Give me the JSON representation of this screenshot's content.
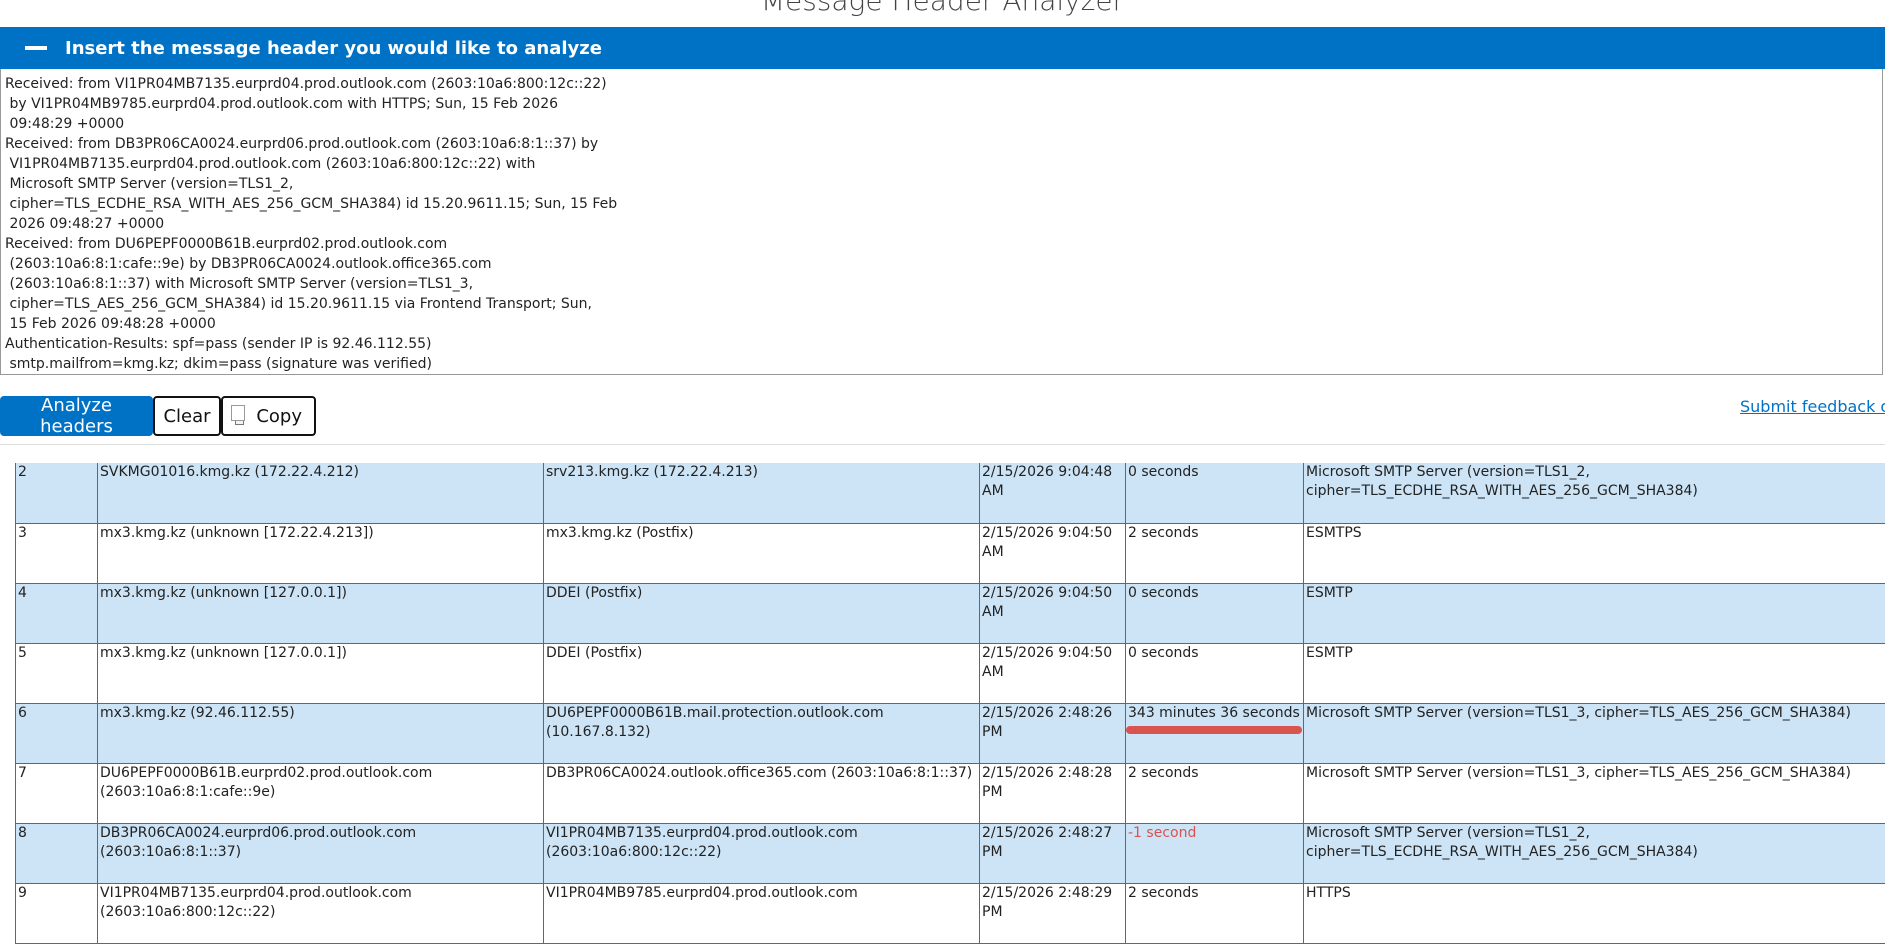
{
  "app": {
    "title": "Message Header Analyzer"
  },
  "section": {
    "title": "Insert the message header you would like to analyze"
  },
  "header_text": "Received: from VI1PR04MB7135.eurprd04.prod.outlook.com (2603:10a6:800:12c::22)\n by VI1PR04MB9785.eurprd04.prod.outlook.com with HTTPS; Sun, 15 Feb 2026\n 09:48:29 +0000\nReceived: from DB3PR06CA0024.eurprd06.prod.outlook.com (2603:10a6:8:1::37) by\n VI1PR04MB7135.eurprd04.prod.outlook.com (2603:10a6:800:12c::22) with\n Microsoft SMTP Server (version=TLS1_2,\n cipher=TLS_ECDHE_RSA_WITH_AES_256_GCM_SHA384) id 15.20.9611.15; Sun, 15 Feb\n 2026 09:48:27 +0000\nReceived: from DU6PEPF0000B61B.eurprd02.prod.outlook.com\n (2603:10a6:8:1:cafe::9e) by DB3PR06CA0024.outlook.office365.com\n (2603:10a6:8:1::37) with Microsoft SMTP Server (version=TLS1_3,\n cipher=TLS_AES_256_GCM_SHA384) id 15.20.9611.15 via Frontend Transport; Sun,\n 15 Feb 2026 09:48:28 +0000\nAuthentication-Results: spf=pass (sender IP is 92.46.112.55)\n smtp.mailfrom=kmg.kz; dkim=pass (signature was verified)",
  "toolbar": {
    "analyze_label": "Analyze headers",
    "clear_label": "Clear",
    "copy_label": "Copy",
    "feedback_label": "Submit feedback on g"
  },
  "hops": [
    {
      "hop": "2",
      "from": "SVKMG01016.kmg.kz (172.22.4.212)",
      "by": "srv213.kmg.kz (172.22.4.213)",
      "time": "2/15/2026 9:04:48 AM",
      "delay": "0 seconds",
      "with": "Microsoft SMTP Server (version=TLS1_2, cipher=TLS_ECDHE_RSA_WITH_AES_256_GCM_SHA384)"
    },
    {
      "hop": "3",
      "from": "mx3.kmg.kz (unknown [172.22.4.213])",
      "by": "mx3.kmg.kz (Postfix)",
      "time": "2/15/2026 9:04:50 AM",
      "delay": "2 seconds",
      "with": "ESMTPS"
    },
    {
      "hop": "4",
      "from": "mx3.kmg.kz (unknown [127.0.0.1])",
      "by": "DDEI (Postfix)",
      "time": "2/15/2026 9:04:50 AM",
      "delay": "0 seconds",
      "with": "ESMTP"
    },
    {
      "hop": "5",
      "from": "mx3.kmg.kz (unknown [127.0.0.1])",
      "by": "DDEI (Postfix)",
      "time": "2/15/2026 9:04:50 AM",
      "delay": "0 seconds",
      "with": "ESMTP"
    },
    {
      "hop": "6",
      "from": "mx3.kmg.kz (92.46.112.55)",
      "by": "DU6PEPF0000B61B.mail.protection.outlook.com (10.167.8.132)",
      "time": "2/15/2026 2:48:26 PM",
      "delay": "343 minutes 36 seconds",
      "with": "Microsoft SMTP Server (version=TLS1_3, cipher=TLS_AES_256_GCM_SHA384)"
    },
    {
      "hop": "7",
      "from": "DU6PEPF0000B61B.eurprd02.prod.outlook.com (2603:10a6:8:1:cafe::9e)",
      "by": "DB3PR06CA0024.outlook.office365.com (2603:10a6:8:1::37)",
      "time": "2/15/2026 2:48:28 PM",
      "delay": "2 seconds",
      "with": "Microsoft SMTP Server (version=TLS1_3, cipher=TLS_AES_256_GCM_SHA384)"
    },
    {
      "hop": "8",
      "from": "DB3PR06CA0024.eurprd06.prod.outlook.com (2603:10a6:8:1::37)",
      "by": "VI1PR04MB7135.eurprd04.prod.outlook.com (2603:10a6:800:12c::22)",
      "time": "2/15/2026 2:48:27 PM",
      "delay": "-1 second",
      "with": "Microsoft SMTP Server (version=TLS1_2, cipher=TLS_ECDHE_RSA_WITH_AES_256_GCM_SHA384)"
    },
    {
      "hop": "9",
      "from": "VI1PR04MB7135.eurprd04.prod.outlook.com (2603:10a6:800:12c::22)",
      "by": "VI1PR04MB9785.eurprd04.prod.outlook.com",
      "time": "2/15/2026 2:48:29 PM",
      "delay": "2 seconds",
      "with": "HTTPS"
    }
  ],
  "colors": {
    "accent": "#0072c6",
    "row_alt": "#cce4f6",
    "warning": "#d9534f"
  }
}
